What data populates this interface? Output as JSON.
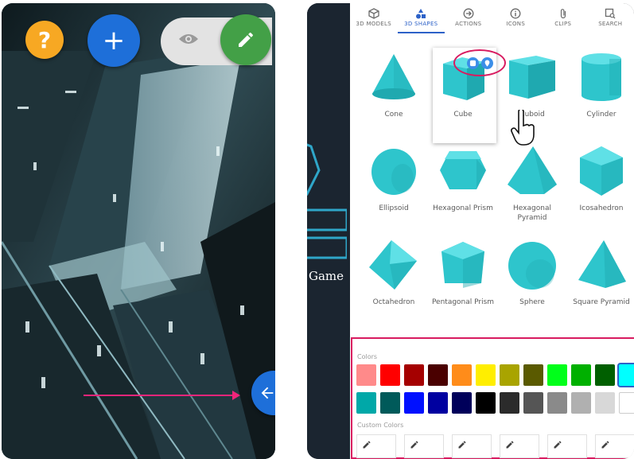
{
  "left_panel": {
    "help_label": "?",
    "add_label": "+",
    "icons": [
      "question-icon",
      "plus-icon",
      "eye-icon",
      "pencil-icon",
      "arrow-left-icon"
    ],
    "accent": {
      "help": "#f7a823",
      "add": "#1e6fd9",
      "edit": "#43a047",
      "arrow": "#f0257a"
    }
  },
  "right_panel": {
    "background_text": "Game",
    "tabs": [
      {
        "label": "3D MODELS",
        "icon": "cube-outline-icon",
        "active": false
      },
      {
        "label": "3D SHAPES",
        "icon": "shapes-icon",
        "active": true
      },
      {
        "label": "ACTIONS",
        "icon": "actions-icon",
        "active": false
      },
      {
        "label": "ICONS",
        "icon": "info-icon",
        "active": false
      },
      {
        "label": "CLIPS",
        "icon": "paperclip-icon",
        "active": false
      },
      {
        "label": "SEARCH",
        "icon": "image-search-icon",
        "active": false
      }
    ],
    "shapes": [
      {
        "label": "Cone",
        "shape": "cone"
      },
      {
        "label": "Cube",
        "shape": "cube"
      },
      {
        "label": "Cuboid",
        "shape": "cuboid"
      },
      {
        "label": "Cylinder",
        "shape": "cylinder"
      },
      {
        "label": "Ellipsoid",
        "shape": "ellipsoid"
      },
      {
        "label": "Hexagonal Prism",
        "shape": "hexprism"
      },
      {
        "label": "Hexagonal Pyramid",
        "shape": "hexpyramid"
      },
      {
        "label": "Icosahedron",
        "shape": "icosa"
      },
      {
        "label": "Octahedron",
        "shape": "octa"
      },
      {
        "label": "Pentagonal Prism",
        "shape": "pentprism"
      },
      {
        "label": "Sphere",
        "shape": "sphere"
      },
      {
        "label": "Square Pyramid",
        "shape": "sqpyramid"
      }
    ],
    "shape_color": "#2ec5cc",
    "colors_label": "Colors",
    "custom_colors_label": "Custom Colors",
    "color_rows": [
      [
        "#ff8a8a",
        "#ff0000",
        "#a50000",
        "#4a0000",
        "#ff8c1a",
        "#ffee00",
        "#a9a400",
        "#5a5a00",
        "#00ff1a",
        "#00b000",
        "#005f00",
        "#00ffff"
      ],
      [
        "#00a8a8",
        "#005a5a",
        "#0010ff",
        "#0000a0",
        "#00005a",
        "#000000",
        "#2b2b2b",
        "#555555",
        "#8a8a8a",
        "#b0b0b0",
        "#d8d8d8",
        "#ffffff"
      ]
    ],
    "selected_color": "#00ffff",
    "custom_color_slots": 6
  }
}
